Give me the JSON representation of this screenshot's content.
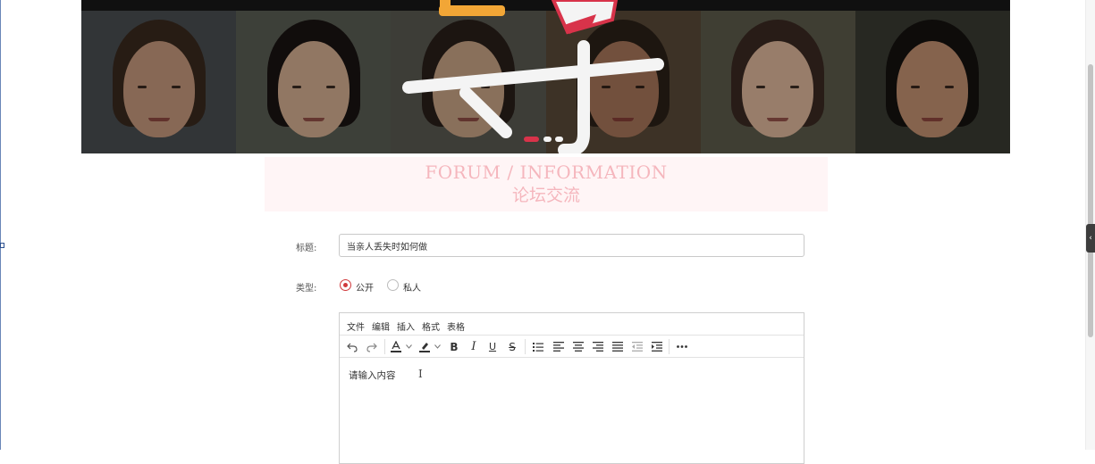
{
  "banner": {
    "faces": [
      {
        "skin": "#c89a7e",
        "hair": "#3a2a1e",
        "bg": "#4a4e52"
      },
      {
        "skin": "#d6b092",
        "hair": "#1a1412",
        "bg": "#5b5f55"
      },
      {
        "skin": "#caa587",
        "hair": "#2a1f1a",
        "bg": "#5a5a52"
      },
      {
        "skin": "#a9775a",
        "hair": "#2c2118",
        "bg": "#5b4a38"
      },
      {
        "skin": "#e0b99c",
        "hair": "#3b2a22",
        "bg": "#5d5c4c"
      },
      {
        "skin": "#c59272",
        "hair": "#151210",
        "bg": "#3a3c33"
      }
    ],
    "accent_colors": {
      "orange": "#f2a636",
      "red": "#d8334a",
      "white": "#f4f4f4"
    }
  },
  "section": {
    "title_en": "FORUM / INFORMATION",
    "title_cn": "论坛交流"
  },
  "form": {
    "title_label": "标题:",
    "title_value": "当亲人丢失时如何做",
    "type_label": "类型:",
    "type_options": [
      "公开",
      "私人"
    ],
    "type_selected": "公开"
  },
  "editor": {
    "menus": [
      "文件",
      "编辑",
      "插入",
      "格式",
      "表格"
    ],
    "toolbar_icons": [
      "undo-icon",
      "redo-icon",
      "font-color-icon",
      "chevron-down-icon",
      "highlight-icon",
      "chevron-down-icon",
      "bold-icon",
      "italic-icon",
      "underline-icon",
      "strikethrough-icon",
      "bullet-list-icon",
      "align-left-icon",
      "align-center-icon",
      "align-right-icon",
      "align-justify-icon",
      "outdent-icon",
      "indent-icon",
      "more-icon"
    ],
    "placeholder": "请输入内容",
    "accent_color": "#d0393c"
  }
}
